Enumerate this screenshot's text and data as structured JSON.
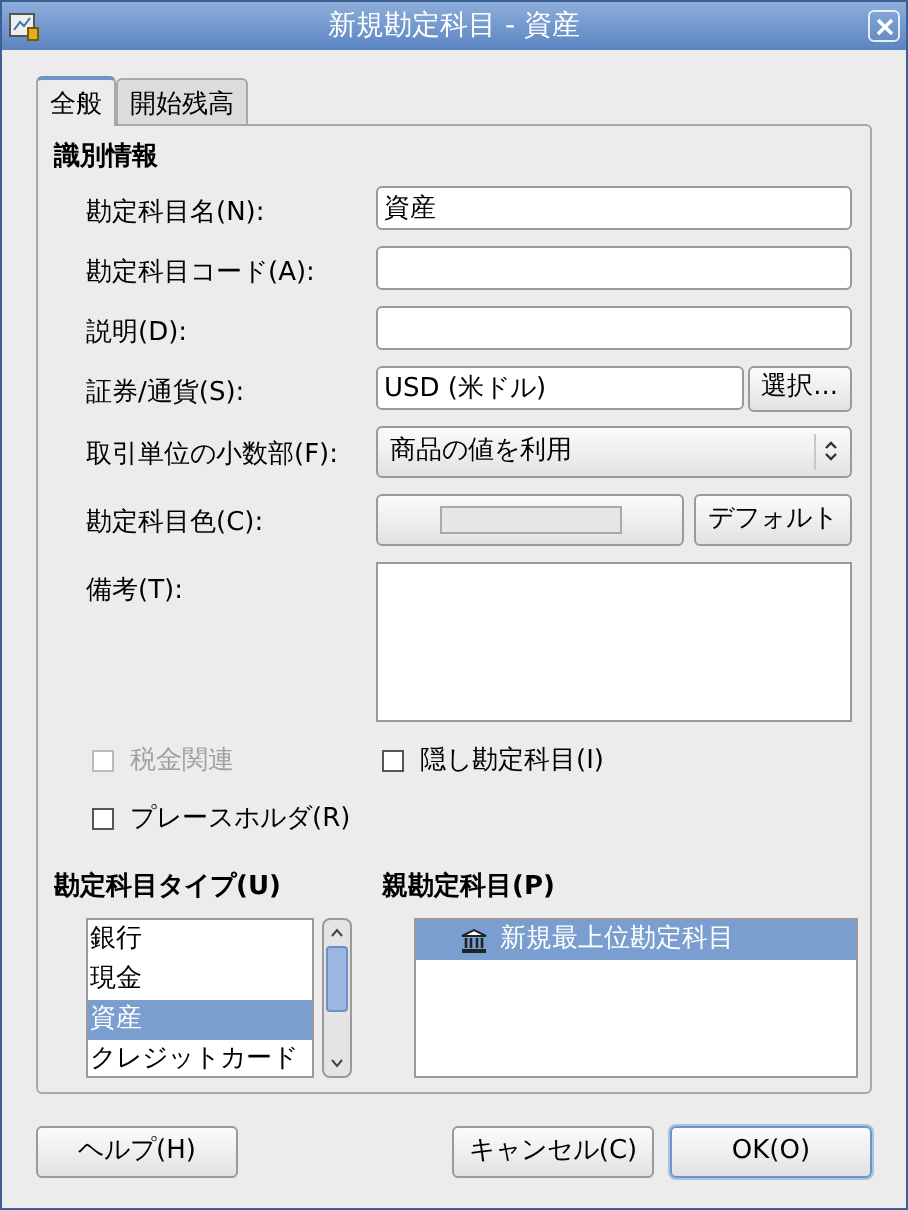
{
  "window": {
    "title": "新規勘定科目 - 資産"
  },
  "tabs": [
    {
      "label": "全般",
      "selected": true
    },
    {
      "label": "開始残高",
      "selected": false
    }
  ],
  "section_title": "識別情報",
  "fields": [
    {
      "kind": "text",
      "label": "勘定科目名(N):",
      "value": "資産"
    },
    {
      "kind": "text",
      "label": "勘定科目コード(A):"
    },
    {
      "kind": "text",
      "label": "説明(D):"
    },
    {
      "kind": "currency",
      "label": "証券/通貨(S):",
      "value": "USD (米ドル)",
      "button": "選択..."
    },
    {
      "kind": "select",
      "label": "取引単位の小数部(F):",
      "value": "商品の値を利用"
    },
    {
      "kind": "color",
      "label": "勘定科目色(C):",
      "button": "デフォルト"
    },
    {
      "kind": "textarea",
      "label": "備考(T):"
    }
  ],
  "checkboxes": [
    {
      "label": "税金関連",
      "checked": false,
      "disabled": true
    },
    {
      "label": "隠し勘定科目(I)",
      "checked": false,
      "disabled": false
    },
    {
      "label": "プレースホルダ(R)",
      "checked": false,
      "disabled": false
    }
  ],
  "account_type": {
    "label": "勘定科目タイプ(U)",
    "items": [
      {
        "label": "銀行",
        "selected": false
      },
      {
        "label": "現金",
        "selected": false
      },
      {
        "label": "資産",
        "selected": true
      },
      {
        "label": "クレジットカード",
        "selected": false
      }
    ]
  },
  "parent_account": {
    "label": "親勘定科目(P)",
    "items": [
      {
        "label": "新規最上位勘定科目",
        "selected": true
      }
    ]
  },
  "buttons": [
    {
      "label": "ヘルプ(H)",
      "default": false
    },
    {
      "label": "キャンセル(C)",
      "default": false
    },
    {
      "label": "OK(O)",
      "default": true
    }
  ]
}
